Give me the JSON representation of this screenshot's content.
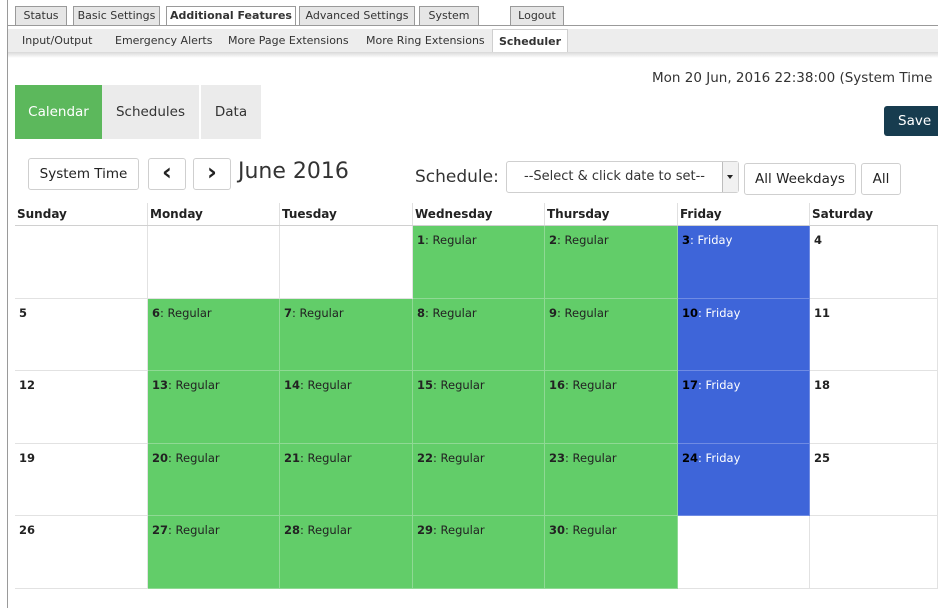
{
  "top_tabs": [
    "Status",
    "Basic Settings",
    "Additional Features",
    "Advanced Settings",
    "System",
    "Logout"
  ],
  "active_top_tab": "Additional Features",
  "sub_tabs": [
    "Input/Output",
    "Emergency Alerts",
    "More Page Extensions",
    "More Ring Extensions",
    "Scheduler"
  ],
  "active_sub_tab": "Scheduler",
  "system_time": "Mon 20 Jun, 2016 22:38:00 (System Time",
  "view_tabs": [
    "Calendar",
    "Schedules",
    "Data"
  ],
  "active_view_tab": "Calendar",
  "save_label": "Save",
  "toolbar": {
    "system_time_button": "System Time",
    "prev_icon": "‹",
    "next_icon": "›",
    "month_label": "June 2016",
    "schedule_label": "Schedule:",
    "schedule_select_value": "--Select & click date to set--",
    "all_weekdays_button": "All Weekdays",
    "all_button": "All"
  },
  "calendar": {
    "days": [
      "Sunday",
      "Monday",
      "Tuesday",
      "Wednesday",
      "Thursday",
      "Friday",
      "Saturday"
    ],
    "weeks": [
      [
        {
          "day": "",
          "sched": ""
        },
        {
          "day": "",
          "sched": ""
        },
        {
          "day": "",
          "sched": ""
        },
        {
          "day": "1",
          "sched": "Regular"
        },
        {
          "day": "2",
          "sched": "Regular"
        },
        {
          "day": "3",
          "sched": "Friday"
        },
        {
          "day": "4",
          "sched": ""
        }
      ],
      [
        {
          "day": "5",
          "sched": ""
        },
        {
          "day": "6",
          "sched": "Regular"
        },
        {
          "day": "7",
          "sched": "Regular"
        },
        {
          "day": "8",
          "sched": "Regular"
        },
        {
          "day": "9",
          "sched": "Regular"
        },
        {
          "day": "10",
          "sched": "Friday"
        },
        {
          "day": "11",
          "sched": ""
        }
      ],
      [
        {
          "day": "12",
          "sched": ""
        },
        {
          "day": "13",
          "sched": "Regular"
        },
        {
          "day": "14",
          "sched": "Regular"
        },
        {
          "day": "15",
          "sched": "Regular"
        },
        {
          "day": "16",
          "sched": "Regular"
        },
        {
          "day": "17",
          "sched": "Friday"
        },
        {
          "day": "18",
          "sched": ""
        }
      ],
      [
        {
          "day": "19",
          "sched": ""
        },
        {
          "day": "20",
          "sched": "Regular"
        },
        {
          "day": "21",
          "sched": "Regular"
        },
        {
          "day": "22",
          "sched": "Regular"
        },
        {
          "day": "23",
          "sched": "Regular"
        },
        {
          "day": "24",
          "sched": "Friday"
        },
        {
          "day": "25",
          "sched": ""
        }
      ],
      [
        {
          "day": "26",
          "sched": ""
        },
        {
          "day": "27",
          "sched": "Regular"
        },
        {
          "day": "28",
          "sched": "Regular"
        },
        {
          "day": "29",
          "sched": "Regular"
        },
        {
          "day": "30",
          "sched": "Regular"
        },
        {
          "day": "",
          "sched": ""
        },
        {
          "day": "",
          "sched": ""
        }
      ]
    ]
  },
  "colors": {
    "regular": "#62cd69",
    "friday": "#3e65d9",
    "active_tab": "#5cb85c",
    "save": "#173c4f"
  }
}
